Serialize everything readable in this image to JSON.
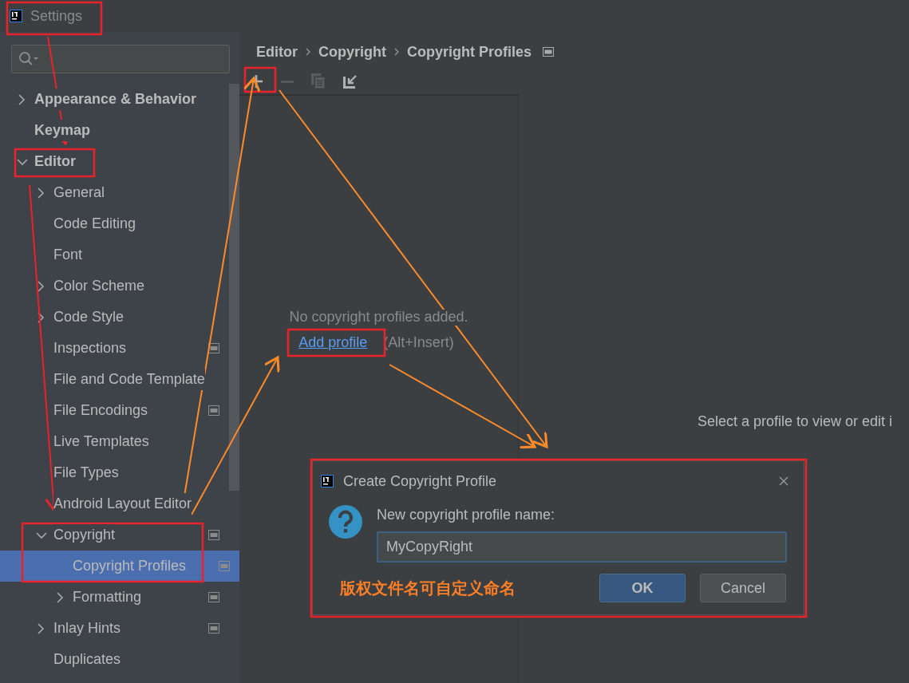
{
  "window": {
    "title": "Settings"
  },
  "tree": [
    {
      "label": "Appearance & Behavior",
      "expanded": false
    },
    {
      "label": "Keymap"
    },
    {
      "label": "Editor",
      "expanded": true,
      "children": [
        {
          "label": "General",
          "expanded": false
        },
        {
          "label": "Code Editing"
        },
        {
          "label": "Font"
        },
        {
          "label": "Color Scheme",
          "expanded": false
        },
        {
          "label": "Code Style",
          "expanded": false
        },
        {
          "label": "Inspections",
          "scope_icon": true
        },
        {
          "label": "File and Code Template"
        },
        {
          "label": "File Encodings",
          "scope_icon": true
        },
        {
          "label": "Live Templates"
        },
        {
          "label": "File Types"
        },
        {
          "label": "Android Layout Editor"
        },
        {
          "label": "Copyright",
          "expanded": true,
          "scope_icon": true,
          "children": [
            {
              "label": "Copyright Profiles",
              "selected": true,
              "scope_icon": true
            },
            {
              "label": "Formatting",
              "expanded": false,
              "scope_icon": true,
              "selected": false
            }
          ]
        },
        {
          "label": "Inlay Hints",
          "expanded": false,
          "scope_icon": true
        },
        {
          "label": "Duplicates"
        }
      ]
    }
  ],
  "breadcrumb": [
    "Editor",
    "Copyright",
    "Copyright Profiles"
  ],
  "toolbar": [
    {
      "kind": "add",
      "disabled": false
    },
    {
      "kind": "remove",
      "disabled": true
    },
    {
      "kind": "copy",
      "disabled": true
    },
    {
      "kind": "import",
      "disabled": false
    }
  ],
  "empty_state": {
    "message": "No copyright profiles added.",
    "link": "Add profile",
    "shortcut": "(Alt+Insert)"
  },
  "detail_hint": "Select a profile to view or edit i",
  "dialog": {
    "title": "Create Copyright Profile",
    "label": "New copyright profile name:",
    "value": "MyCopyRight",
    "note": "版权文件名可自定义命名",
    "buttons": [
      {
        "label": "OK",
        "kind": "primary"
      },
      {
        "label": "Cancel",
        "kind": "secondary"
      }
    ]
  }
}
